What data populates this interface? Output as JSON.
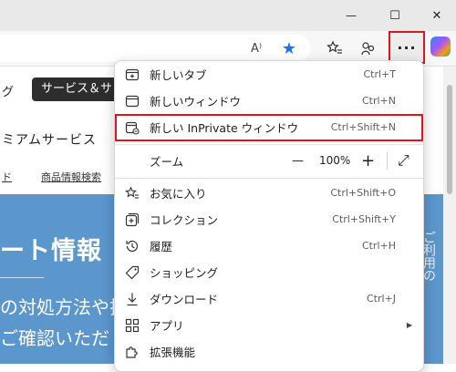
{
  "window": {
    "controls": {
      "minimize": "—",
      "maximize": "☐",
      "close": "✕"
    }
  },
  "toolbar": {
    "read_aloud_icon": "A⁾",
    "favorite_icon": "★",
    "menu_label": "···"
  },
  "page": {
    "nav_left_text": "グ",
    "nav_pill": "サービス＆サ",
    "premium_text": "ミアムサービス",
    "link_left": "ド",
    "link_product_search": "商品情報検索",
    "hero_title": "ート情報",
    "hero_line1": "の対処方法や拉",
    "hero_line2": "ご確認いただ",
    "right_edge_text": "ご利用の"
  },
  "menu": {
    "items": [
      {
        "label": "新しいタブ",
        "shortcut": "Ctrl+T"
      },
      {
        "label": "新しいウィンドウ",
        "shortcut": "Ctrl+N"
      },
      {
        "label": "新しい InPrivate ウィンドウ",
        "shortcut": "Ctrl+Shift+N"
      },
      {
        "label": "ズーム",
        "zoom_minus": "—",
        "zoom_value": "100%",
        "zoom_plus": "+",
        "fullscreen": "⤢"
      },
      {
        "label": "お気に入り",
        "shortcut": "Ctrl+Shift+O"
      },
      {
        "label": "コレクション",
        "shortcut": "Ctrl+Shift+Y"
      },
      {
        "label": "履歴",
        "shortcut": "Ctrl+H"
      },
      {
        "label": "ショッピング",
        "shortcut": ""
      },
      {
        "label": "ダウンロード",
        "shortcut": "Ctrl+J"
      },
      {
        "label": "アプリ",
        "submenu_arrow": "▶"
      },
      {
        "label": "拡張機能",
        "shortcut": ""
      }
    ]
  },
  "colors": {
    "highlight_border": "#e0141e",
    "hero_bg": "#5b96cc",
    "favorite_star": "#1a73e8"
  }
}
